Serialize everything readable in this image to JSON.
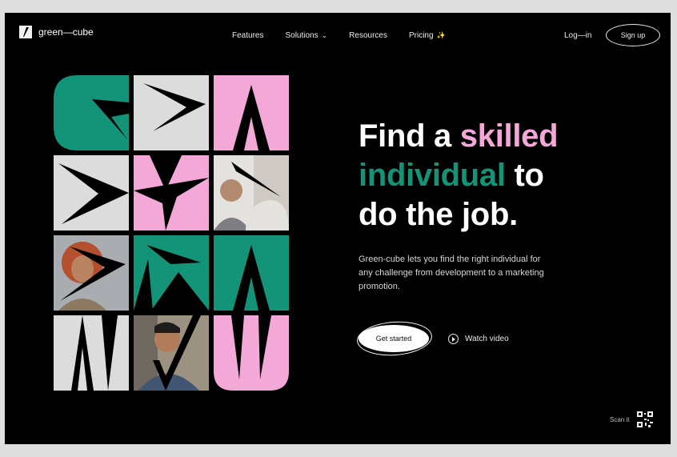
{
  "brand": {
    "name": "green—cube"
  },
  "nav": {
    "features": "Features",
    "solutions": "Solutions",
    "resources": "Resources",
    "pricing": "Pricing",
    "pricing_badge": "✨"
  },
  "auth": {
    "login": "Log—in",
    "signup": "Sign up"
  },
  "hero": {
    "line1_a": "Find a ",
    "line1_b": "skilled",
    "line2_a": "individual",
    "line2_b": " to",
    "line3": "do the job.",
    "description": "Green-cube lets you find the right individual for any challenge from development to a marketing promotion.",
    "cta": "Get started",
    "watch": "Watch video"
  },
  "footer": {
    "scan": "Scan it"
  },
  "colors": {
    "green": "#139377",
    "pink": "#f3a8d8",
    "grey": "#dcdcdc",
    "bg": "#000000"
  }
}
